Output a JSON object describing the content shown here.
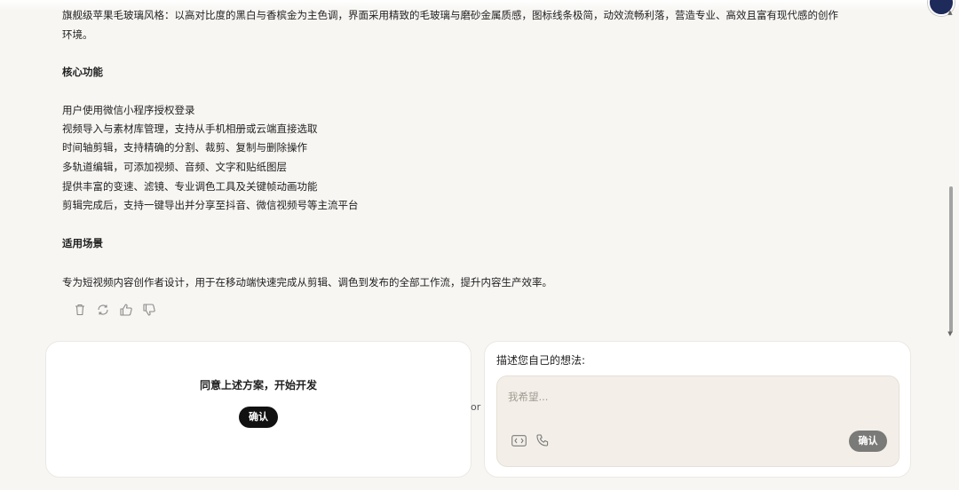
{
  "document": {
    "intro_line_1": "旗舰级苹果毛玻璃风格：以高对比度的黑白与香槟金为主色调，界面采用精致的毛玻璃与磨砂金属质感，图标线条极简，动效流畅利落，营造专业、高效且富有现代感的创作",
    "intro_line_2": "环境。",
    "core_heading": "核心功能",
    "features": [
      "用户使用微信小程序授权登录",
      "视频导入与素材库管理，支持从手机相册或云端直接选取",
      "时间轴剪辑，支持精确的分割、裁剪、复制与删除操作",
      "多轨道编辑，可添加视频、音频、文字和贴纸图层",
      "提供丰富的变速、滤镜、专业调色工具及关键帧动画功能",
      "剪辑完成后，支持一键导出并分享至抖音、微信视频号等主流平台"
    ],
    "scenario_heading": "适用场景",
    "scenario_text": "专为短视频内容创作者设计，用于在移动端快速完成从剪辑、调色到发布的全部工作流，提升内容生产效率。"
  },
  "feedback_icons": [
    "trash-icon",
    "refresh-icon",
    "thumbs-up-icon",
    "thumbs-down-icon"
  ],
  "approve_card": {
    "text": "同意上述方案，开始开发",
    "button_label": "确认"
  },
  "or_label": "or",
  "idea_card": {
    "title": "描述您自己的想法:",
    "placeholder": "我希望...",
    "icons": [
      "code-icon",
      "phone-icon"
    ],
    "button_label": "确认"
  },
  "colors": {
    "background": "#f7f6f3",
    "card": "#ffffff",
    "input_box": "#f3efe8",
    "primary_button": "#111111",
    "secondary_button": "#7a7a78"
  }
}
